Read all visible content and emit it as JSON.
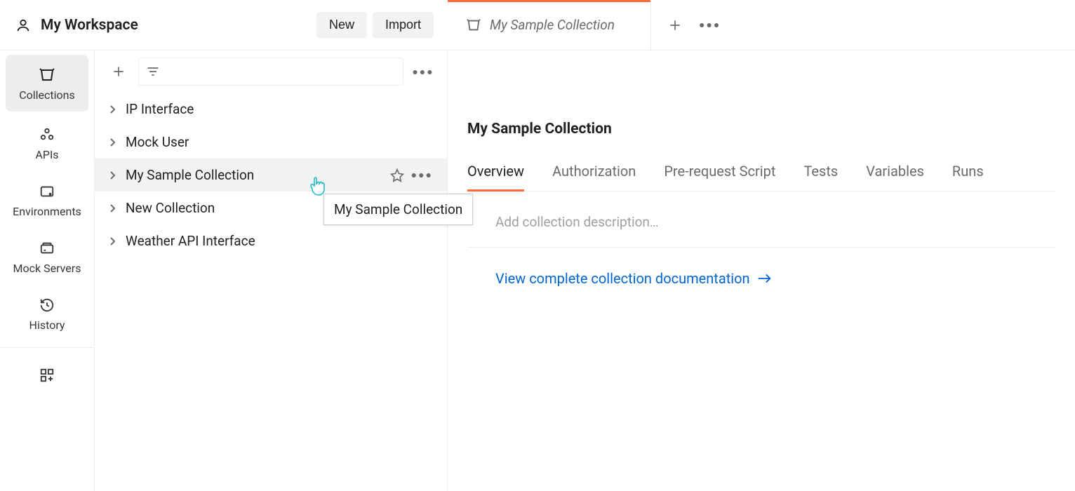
{
  "workspace": {
    "title": "My Workspace"
  },
  "header": {
    "new_label": "New",
    "import_label": "Import"
  },
  "nav_rail": {
    "items": [
      {
        "label": "Collections"
      },
      {
        "label": "APIs"
      },
      {
        "label": "Environments"
      },
      {
        "label": "Mock Servers"
      },
      {
        "label": "History"
      }
    ]
  },
  "collections": {
    "items": [
      {
        "name": "IP Interface"
      },
      {
        "name": "Mock User"
      },
      {
        "name": "My Sample Collection"
      },
      {
        "name": "New Collection"
      },
      {
        "name": "Weather API Interface"
      }
    ]
  },
  "tooltip": {
    "text": "My Sample Collection"
  },
  "tabs": {
    "items": [
      {
        "label": "My Sample Collection"
      }
    ]
  },
  "content": {
    "title": "My Sample Collection",
    "sub_tabs": [
      {
        "label": "Overview"
      },
      {
        "label": "Authorization"
      },
      {
        "label": "Pre-request Script"
      },
      {
        "label": "Tests"
      },
      {
        "label": "Variables"
      },
      {
        "label": "Runs"
      }
    ],
    "description_placeholder": "Add collection description…",
    "doc_link": "View complete collection documentation"
  }
}
